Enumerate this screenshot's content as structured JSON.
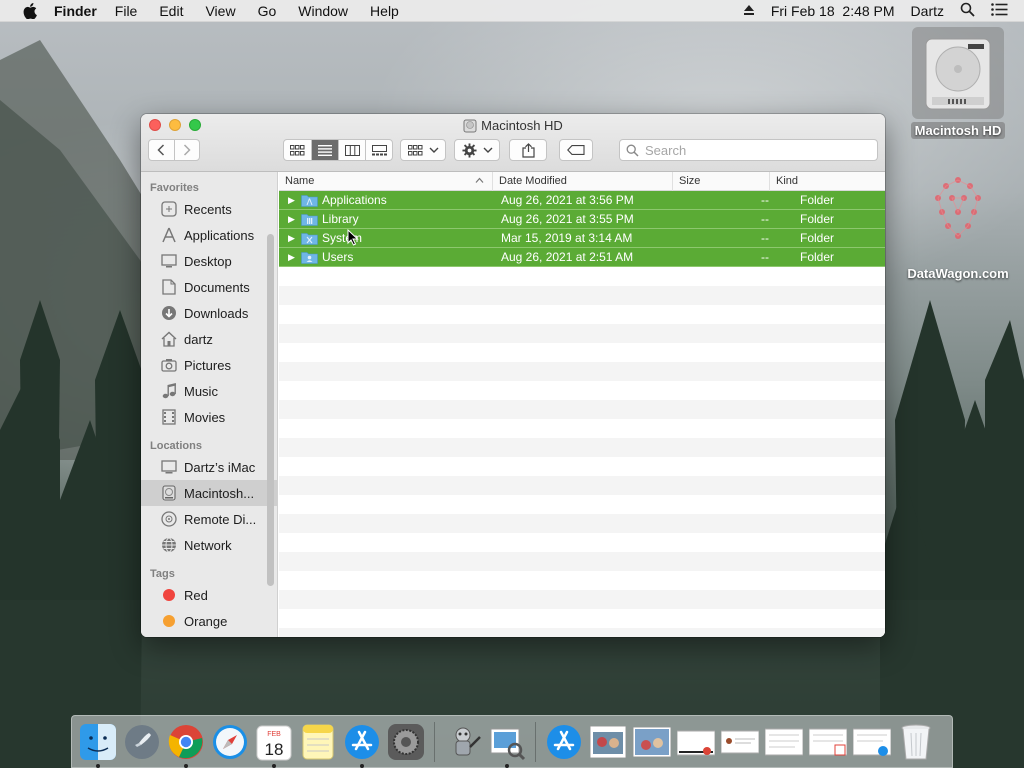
{
  "menubar": {
    "app_name": "Finder",
    "menus": [
      "File",
      "Edit",
      "View",
      "Go",
      "Window",
      "Help"
    ],
    "datetime": "Fri Feb 18  2:48 PM",
    "user": "Dartz"
  },
  "desktop": {
    "hd_label": "Macintosh HD",
    "datawagon_label": "DataWagon.com"
  },
  "window": {
    "title": "Macintosh HD",
    "search_placeholder": "Search"
  },
  "sidebar": {
    "favorites_heading": "Favorites",
    "favorites": [
      "Recents",
      "Applications",
      "Desktop",
      "Documents",
      "Downloads",
      "dartz",
      "Pictures",
      "Music",
      "Movies"
    ],
    "locations_heading": "Locations",
    "locations": [
      "Dartz’s iMac",
      "Macintosh...",
      "Remote Di...",
      "Network"
    ],
    "tags_heading": "Tags",
    "tags": [
      "Red",
      "Orange"
    ],
    "tag_colors": [
      "#f0453e",
      "#f6a031"
    ]
  },
  "columns": {
    "name": "Name",
    "date": "Date Modified",
    "size": "Size",
    "kind": "Kind"
  },
  "files": [
    {
      "name": "Applications",
      "date": "Aug 26, 2021 at 3:56 PM",
      "size": "--",
      "kind": "Folder"
    },
    {
      "name": "Library",
      "date": "Aug 26, 2021 at 3:55 PM",
      "size": "--",
      "kind": "Folder"
    },
    {
      "name": "System",
      "date": "Mar 15, 2019 at 3:14 AM",
      "size": "--",
      "kind": "Folder"
    },
    {
      "name": "Users",
      "date": "Aug 26, 2021 at 2:51 AM",
      "size": "--",
      "kind": "Folder"
    }
  ],
  "dock": {
    "calendar_day": "18",
    "calendar_month": "FEB"
  },
  "colors": {
    "selection": "#5bab35",
    "folder": "#6fb6e6"
  }
}
